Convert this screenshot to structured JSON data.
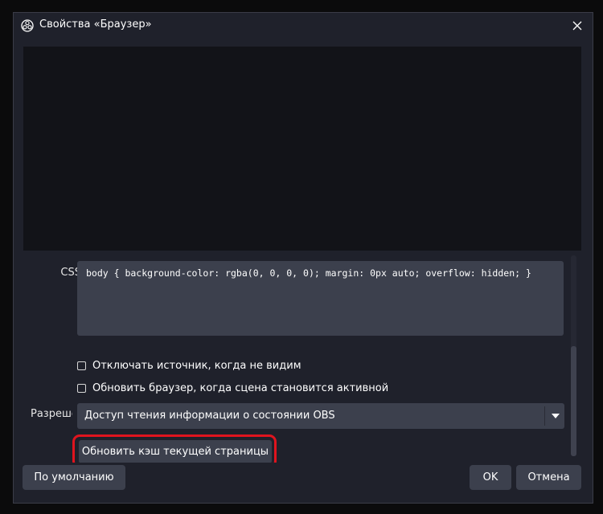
{
  "window": {
    "title": "Свойства «Браузер»"
  },
  "properties": {
    "css_label": "CSS",
    "css_value": "body { background-color: rgba(0, 0, 0, 0); margin: 0px auto; overflow: hidden; }",
    "checkboxes": [
      {
        "label": "Отключать источник, когда не видим",
        "checked": false
      },
      {
        "label": "Обновить браузер, когда сцена становится активной",
        "checked": false
      }
    ],
    "permissions_label": "Разрешения",
    "permissions_value": "Доступ чтения информации о состоянии OBS",
    "refresh_cache_label": "Обновить кэш текущей страницы"
  },
  "footer": {
    "defaults_label": "По умолчанию",
    "ok_label": "OK",
    "cancel_label": "Отмена"
  },
  "colors": {
    "background": "#1f212b",
    "field": "#3c404d",
    "highlight": "#e0141e"
  },
  "icons": {
    "app": "obs-logo-icon",
    "close": "close-icon",
    "dropdown": "chevron-down-icon"
  }
}
